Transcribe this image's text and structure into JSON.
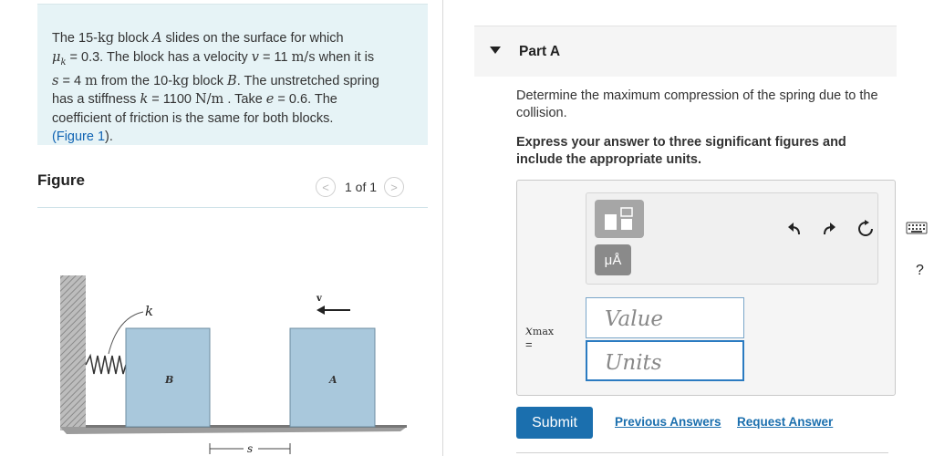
{
  "problem": {
    "p1": "The 15-",
    "kg1": "kg",
    "p2": " block ",
    "blockA": "A",
    "p3": " slides on the surface for which",
    "mu": "μ",
    "mu_sub": "k",
    "p4": " = 0.3. The block has a velocity ",
    "v": "v",
    "p5": " = 11 ",
    "vel_unit": "m/s",
    "p6": " when it is",
    "s": "s",
    "p7": " = 4 ",
    "m": "m",
    "p8": " from the 10-",
    "kg2": "kg",
    "p9": " block ",
    "blockB": "B",
    "p10": ". The unstretched spring",
    "p11": "has a stiffness ",
    "k": "k",
    "p12": " = 1100 ",
    "k_unit": "N/m",
    "p13": " . Take ",
    "e": "e",
    "p14": " = 0.6. The",
    "p15": "coefficient of friction is the same for both blocks.",
    "fig_open": "(",
    "fig_link": "Figure 1",
    "fig_close": ")."
  },
  "figure": {
    "label": "Figure",
    "pager_text": "1 of 1",
    "prev_glyph": "<",
    "next_glyph": ">",
    "labels": {
      "k": "k",
      "v": "v",
      "B": "B",
      "A": "A",
      "s": "s"
    }
  },
  "part": {
    "title": "Part A",
    "question": "Determine the maximum compression of the spring due to the collision.",
    "instruction": "Express your answer to three significant figures and include the appropriate units."
  },
  "answer": {
    "mu_button": "μÅ",
    "help": "?",
    "var_name": "x",
    "var_sub": "max",
    "equals": "=",
    "value_placeholder": "Value",
    "units_placeholder": "Units"
  },
  "actions": {
    "submit": "Submit",
    "previous_answers": "Previous Answers",
    "request_answer": "Request Answer"
  },
  "colors": {
    "problem_bg": "#e6f3f6",
    "link": "#0f63b3",
    "submit_bg": "#1b6fae",
    "block_fill": "#a9c8dc",
    "ground_fill": "#9c9c9c"
  }
}
